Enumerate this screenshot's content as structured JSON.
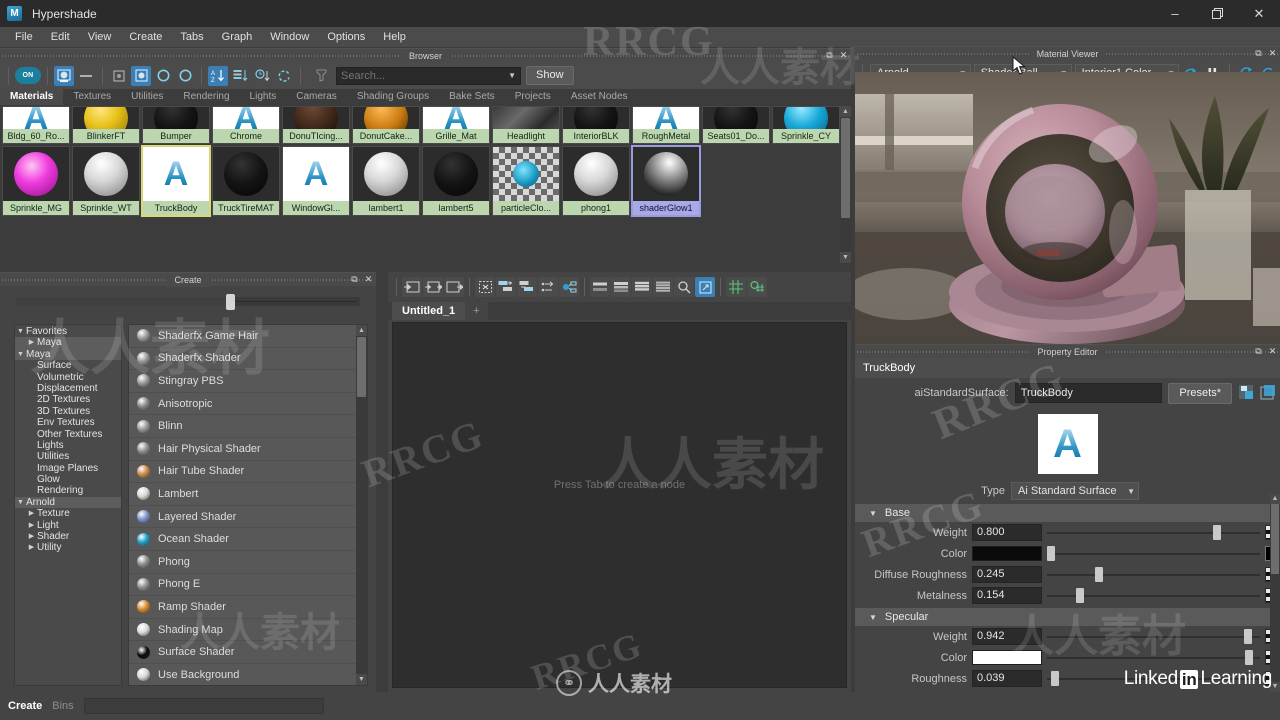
{
  "window": {
    "app_title": "Hypershade",
    "logo_letter": "M",
    "minimize": "–",
    "restore": "❐",
    "close": "✕"
  },
  "menubar": [
    "File",
    "Edit",
    "View",
    "Create",
    "Tabs",
    "Graph",
    "Window",
    "Options",
    "Help"
  ],
  "browser": {
    "panel_title": "Browser",
    "toolbar": {
      "on_toggle": "ON",
      "show_button": "Show"
    },
    "search": {
      "placeholder": "Search...",
      "value": ""
    },
    "bin_tabs": [
      "Materials",
      "Textures",
      "Utilities",
      "Rendering",
      "Lights",
      "Cameras",
      "Shading Groups",
      "Bake Sets",
      "Projects",
      "Asset Nodes"
    ],
    "active_bin_tab": "Materials",
    "row1": [
      {
        "name": "Bldg_60_Ro...",
        "kind": "arnold"
      },
      {
        "name": "BlinkerFT",
        "kind": "yellow"
      },
      {
        "name": "Bumper",
        "kind": "black"
      },
      {
        "name": "Chrome",
        "kind": "arnold"
      },
      {
        "name": "DonuTIcing...",
        "kind": "darkbrown"
      },
      {
        "name": "DonutCake...",
        "kind": "orange"
      },
      {
        "name": "Grille_Mat",
        "kind": "arnold"
      },
      {
        "name": "Headlight",
        "kind": "photo"
      },
      {
        "name": "InteriorBLK",
        "kind": "black"
      },
      {
        "name": "RoughMetal",
        "kind": "arnold"
      },
      {
        "name": "Seats01_Do...",
        "kind": "black"
      },
      {
        "name": "Sprinkle_CY",
        "kind": "cyan"
      }
    ],
    "row2": [
      {
        "name": "Sprinkle_MG",
        "kind": "magenta",
        "selected": false
      },
      {
        "name": "Sprinkle_WT",
        "kind": "white",
        "selected": false
      },
      {
        "name": "TruckBody",
        "kind": "arnold",
        "selected": true
      },
      {
        "name": "TruckTireMAT",
        "kind": "black",
        "selected": false
      },
      {
        "name": "WindowGl...",
        "kind": "arnold",
        "selected": false
      },
      {
        "name": "lambert1",
        "kind": "white",
        "selected": false
      },
      {
        "name": "lambert5",
        "kind": "black",
        "selected": false
      },
      {
        "name": "particleClo...",
        "kind": "checker",
        "selected": false
      },
      {
        "name": "phong1",
        "kind": "white",
        "selected": false
      },
      {
        "name": "shaderGlow1",
        "kind": "glow",
        "selected": true,
        "label_style": "blue"
      }
    ]
  },
  "create": {
    "panel_title": "Create",
    "tree": [
      {
        "label": "Favorites",
        "indent": 0,
        "twisty": "▼",
        "highlight": false
      },
      {
        "label": "Maya",
        "indent": 1,
        "twisty": "▶",
        "highlight": true
      },
      {
        "label": "Maya",
        "indent": 0,
        "twisty": "▼",
        "highlight": true
      },
      {
        "label": "Surface",
        "indent": 1,
        "twisty": "",
        "highlight": false
      },
      {
        "label": "Volumetric",
        "indent": 1,
        "twisty": "",
        "highlight": false
      },
      {
        "label": "Displacement",
        "indent": 1,
        "twisty": "",
        "highlight": false
      },
      {
        "label": "2D Textures",
        "indent": 1,
        "twisty": "",
        "highlight": false
      },
      {
        "label": "3D Textures",
        "indent": 1,
        "twisty": "",
        "highlight": false
      },
      {
        "label": "Env Textures",
        "indent": 1,
        "twisty": "",
        "highlight": false
      },
      {
        "label": "Other Textures",
        "indent": 1,
        "twisty": "",
        "highlight": false
      },
      {
        "label": "Lights",
        "indent": 1,
        "twisty": "",
        "highlight": false
      },
      {
        "label": "Utilities",
        "indent": 1,
        "twisty": "",
        "highlight": false
      },
      {
        "label": "Image Planes",
        "indent": 1,
        "twisty": "",
        "highlight": false
      },
      {
        "label": "Glow",
        "indent": 1,
        "twisty": "",
        "highlight": false
      },
      {
        "label": "Rendering",
        "indent": 1,
        "twisty": "",
        "highlight": false
      },
      {
        "label": "Arnold",
        "indent": 0,
        "twisty": "▼",
        "highlight": true
      },
      {
        "label": "Texture",
        "indent": 1,
        "twisty": "▶",
        "highlight": false
      },
      {
        "label": "Light",
        "indent": 1,
        "twisty": "▶",
        "highlight": false
      },
      {
        "label": "Shader",
        "indent": 1,
        "twisty": "▶",
        "highlight": false
      },
      {
        "label": "Utility",
        "indent": 1,
        "twisty": "▶",
        "highlight": false
      }
    ],
    "nodes": [
      {
        "label": "Shaderfx Game Hair",
        "color": "#9a9a9a"
      },
      {
        "label": "Shaderfx Shader",
        "color": "#9a9a9a"
      },
      {
        "label": "Stingray PBS",
        "color": "#9a9a9a"
      },
      {
        "label": "Anisotropic",
        "color": "#8a8a8a"
      },
      {
        "label": "Blinn",
        "color": "#9a9a9a"
      },
      {
        "label": "Hair Physical Shader",
        "color": "#8f8f8f"
      },
      {
        "label": "Hair Tube Shader",
        "color": "#c98b4b"
      },
      {
        "label": "Lambert",
        "color": "#d8d8d8"
      },
      {
        "label": "Layered Shader",
        "color": "#7f93c8"
      },
      {
        "label": "Ocean Shader",
        "color": "#1e9ec6"
      },
      {
        "label": "Phong",
        "color": "#8f8f8f"
      },
      {
        "label": "Phong E",
        "color": "#8f8f8f"
      },
      {
        "label": "Ramp Shader",
        "color": "#d98b2a"
      },
      {
        "label": "Shading Map",
        "color": "#dcdcdc"
      },
      {
        "label": "Surface Shader",
        "color": "#0a0a0a"
      },
      {
        "label": "Use Background",
        "color": "#d8d8d8"
      }
    ]
  },
  "work": {
    "tabs": [
      {
        "label": "Untitled_1",
        "active": true
      }
    ],
    "new_tab_label": "+",
    "canvas_hint": "Press Tab to create a node"
  },
  "material_viewer": {
    "panel_title": "Material Viewer",
    "renderer": "Arnold",
    "geometry": "Shader Ball",
    "environment": "Interior1 Color"
  },
  "property_editor": {
    "panel_title": "Property Editor",
    "selected_node": "TruckBody",
    "node_type_label": "aiStandardSurface:",
    "node_name": "TruckBody",
    "presets_label": "Presets*",
    "type_label": "Type",
    "type_value": "Ai Standard Surface",
    "sections": [
      {
        "title": "Base",
        "attrs": [
          {
            "label": "Weight",
            "value": "0.800",
            "slider": 0.8,
            "widget": "number",
            "map": "checker"
          },
          {
            "label": "Color",
            "value": "",
            "slider": 0.02,
            "widget": "color",
            "color": "#0a0a0a",
            "map": "arrow"
          },
          {
            "label": "Diffuse Roughness",
            "value": "0.245",
            "slider": 0.245,
            "widget": "number",
            "map": "checker"
          },
          {
            "label": "Metalness",
            "value": "0.154",
            "slider": 0.154,
            "widget": "number",
            "map": "checker"
          }
        ]
      },
      {
        "title": "Specular",
        "attrs": [
          {
            "label": "Weight",
            "value": "0.942",
            "slider": 0.942,
            "widget": "number",
            "map": "checker"
          },
          {
            "label": "Color",
            "value": "",
            "slider": 0.95,
            "widget": "color",
            "color": "#ffffff",
            "map": "checker"
          },
          {
            "label": "Roughness",
            "value": "0.039",
            "slider": 0.039,
            "widget": "number",
            "map": "checker"
          }
        ]
      }
    ]
  },
  "bottom_bar": {
    "tabs": [
      "Create",
      "Bins"
    ],
    "active_tab": "Create",
    "field_value": ""
  },
  "watermarks": {
    "brand": "RRCG",
    "cn_text": "人人素材",
    "linkedin_prefix": "Linked",
    "linkedin_in": "in",
    "linkedin_suffix": "Learning"
  },
  "colors": {
    "accent_blue": "#3b7fb5",
    "panel_bg": "#444444",
    "toolbar_bg": "#4b4b4b",
    "swatch_label_green": "#bcd7b0",
    "selection_yellow": "#d8d878",
    "selection_violet": "#9a9ae0"
  }
}
